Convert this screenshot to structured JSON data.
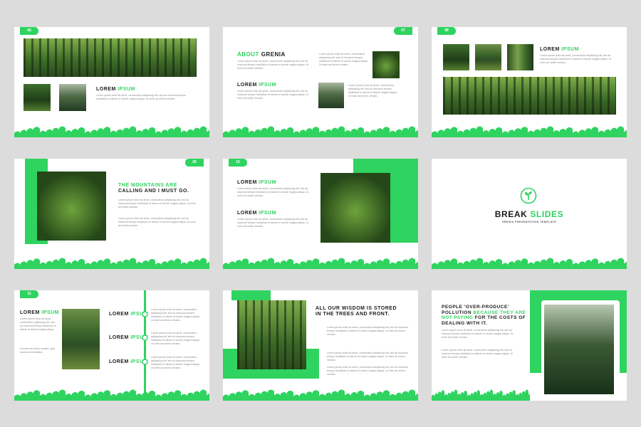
{
  "brand_color": "#2fd35f",
  "page_numbers": [
    "06",
    "07",
    "08",
    "09",
    "10",
    "11"
  ],
  "lorem": {
    "part1": "LOREM",
    "part2": "IPSUM"
  },
  "filler": "Lorem ipsum dolor sit amet, consectetur adipiscing elit, sed do eiusmod tempor incididunt ut labore et dolore magna aliqua. Ut enim ad minim veniam.",
  "filler_short": "Lorem ipsum dolor sit amet, consectetur adipiscing elit, sed do eiusmod tempor incididunt ut labore et dolore magna aliqua. Ut enim ad minim veniam.",
  "slide2": {
    "title1": "ABOUT",
    "title2": "GRENIA"
  },
  "slide4": {
    "line1a": "THE MOUNTAINS ARE",
    "line2": "CALLING AND I MUST GO."
  },
  "slide6": {
    "title1": "BREAK",
    "title2": "SLIDES",
    "subtitle": "GRENIA PRESENTATION TEMPLATE",
    "icon": "seedling-icon"
  },
  "slide7": {
    "left_text_a": "Lorem ipsum dolor sit amet, consectetur adipiscing elit, sed do eiusmod tempor incididunt ut labore et dolore magna aliqua.",
    "left_text_b": "Ut enim ad minim veniam, quis nostrud exercitation."
  },
  "slide8": {
    "line1": "ALL OUR WISDOM IS STORED",
    "line2": "IN THE TREES AND FRONT."
  },
  "slide9": {
    "line1": "PEOPLE 'OVER-PRODUCE'",
    "line2a": "POLLUTION",
    "line2b": "BECAUSE THEY ARE",
    "line3a": "NOT PAYING",
    "line3b": "FOR THE COSTS OF",
    "line4": "DEALING WITH IT."
  }
}
